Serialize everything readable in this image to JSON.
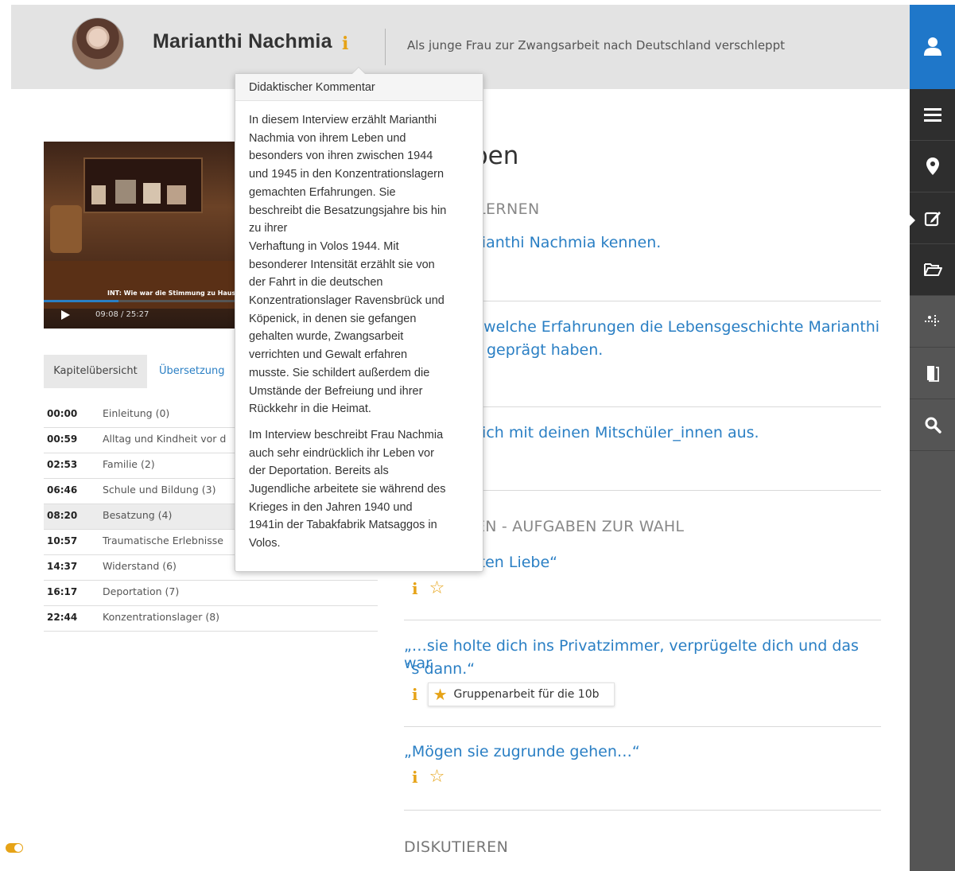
{
  "header": {
    "name": "Marianthi Nachmia",
    "info_icon": "i",
    "subtitle": "Als junge Frau zur Zwangsarbeit nach Deutschland verschleppt"
  },
  "video": {
    "subtitle": "INT: Wie war die Stimmung zu Haus",
    "time": "09:08 / 25:27",
    "progress": 0.36
  },
  "tabs": {
    "chapters": "Kapitelübersicht",
    "translation": "Übersetzung"
  },
  "chapters": [
    {
      "time": "00:00",
      "title": "Einleitung (0)"
    },
    {
      "time": "00:59",
      "title": "Alltag und Kindheit vor d"
    },
    {
      "time": "02:53",
      "title": "Familie (2)"
    },
    {
      "time": "06:46",
      "title": "Schule und Bildung (3)"
    },
    {
      "time": "08:20",
      "title": "Besatzung (4)"
    },
    {
      "time": "10:57",
      "title": "Traumatische Erlebnisse"
    },
    {
      "time": "14:37",
      "title": "Widerstand (6)"
    },
    {
      "time": "16:17",
      "title": "Deportation (7)"
    },
    {
      "time": "22:44",
      "title": "Konzentrationslager (8)"
    }
  ],
  "popup": {
    "title": "Didaktischer Kommentar",
    "p1": "In diesem Interview erzählt Marianthi\nNachmia von ihrem Leben und\nbesonders von ihren zwischen 1944\nund 1945 in den Konzentrationslagern\ngemachten Erfahrungen. Sie\nbeschreibt die Besatzungsjahre bis hin\nzu ihrer\nVerhaftung in Volos 1944. Mit\nbesonderer Intensität erzählt sie von\nder Fahrt in die deutschen\nKonzentrationslager Ravensbrück und\nKöpenick, in denen sie gefangen\ngehalten wurde, Zwangsarbeit\nverrichten und Gewalt erfahren\nmusste. Sie schildert außerdem die\nUmstände der Befreiung und ihrer\nRückkehr in die Heimat.",
    "p2": "Im Interview beschreibt Frau Nachmia\nauch sehr eindrücklich ihr Leben vor\nder Deportation. Bereits als\nJugendliche arbeitete sie während des\nKrieges in den Jahren 1940 und\n1941in der Tabakfabrik Matsaggos in\nVolos."
  },
  "main": {
    "heading_fragment": "ben",
    "section1_fragment": "LERNEN",
    "task1": "rianthi Nachmia kennen.",
    "task2_line1": ", welche Erfahrungen die Lebensgeschichte Marianthi",
    "task2_line2": "s geprägt haben.",
    "task3": "dich mit deinen Mitschüler_innen aus.",
    "section2_fragment": "EN - AUFGABEN ZUR WAHL",
    "option1": "„…wir hatten Liebe“",
    "option2_line1": "„…sie holte dich ins Privatzimmer, verprügelte dich und das war",
    "option2_line2": "´s dann.“",
    "option2_group": "Gruppenarbeit für die 10b",
    "option3": "„Mögen sie zugrunde gehen…“",
    "section3": "DISKUTIEREN"
  },
  "icons": {
    "info": "i",
    "star_outline": "☆",
    "star_filled": "★"
  },
  "colors": {
    "accent_blue": "#1f77c9",
    "link_blue": "#2a7fc4",
    "info_orange": "#e6a317",
    "sidebar": "#555555"
  }
}
